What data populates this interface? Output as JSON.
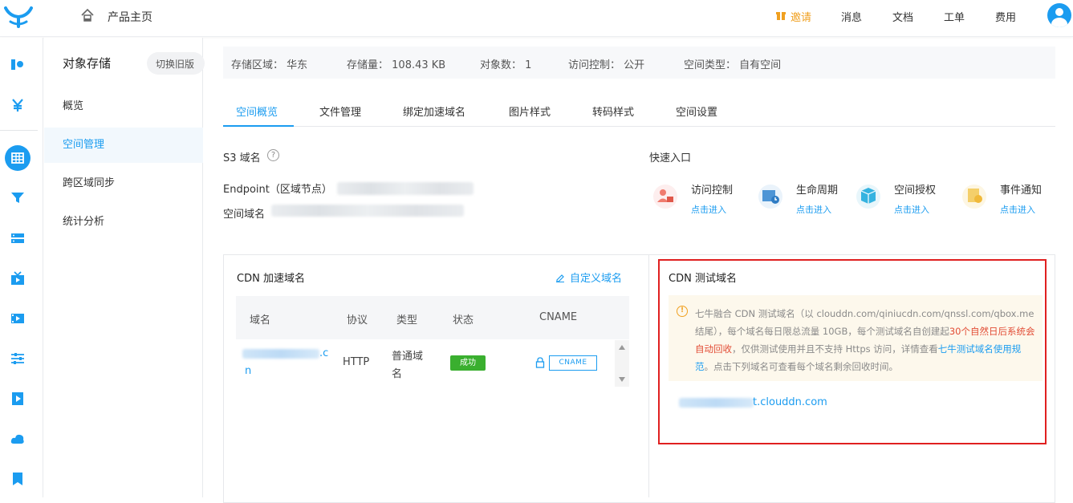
{
  "header": {
    "home_label": "产品主页",
    "nav": [
      "邀请",
      "消息",
      "文档",
      "工单",
      "费用"
    ]
  },
  "colors": {
    "accent": "#1b9cf0",
    "success": "#3aaf2f",
    "highlight_border": "#e02020",
    "warning": "#f0a020"
  },
  "sidebar": {
    "title": "对象存储",
    "switch_label": "切换旧版",
    "items": [
      {
        "label": "概览"
      },
      {
        "label": "空间管理",
        "active": true
      },
      {
        "label": "跨区域同步"
      },
      {
        "label": "统计分析"
      }
    ]
  },
  "info": [
    {
      "label": "存储区域：",
      "value": "华东"
    },
    {
      "label": "存储量：",
      "value": "108.43 KB"
    },
    {
      "label": "对象数：",
      "value": "1"
    },
    {
      "label": "访问控制：",
      "value": "公开"
    },
    {
      "label": "空间类型：",
      "value": "自有空间"
    }
  ],
  "tabs": [
    {
      "label": "空间概览",
      "active": true
    },
    {
      "label": "文件管理"
    },
    {
      "label": "绑定加速域名"
    },
    {
      "label": "图片样式"
    },
    {
      "label": "转码样式"
    },
    {
      "label": "空间设置"
    }
  ],
  "s3": {
    "title": "S3 域名",
    "endpoint_label": "Endpoint（区域节点）",
    "bucket_domain_label": "空间域名"
  },
  "quick": {
    "title": "快速入口",
    "items": [
      {
        "label": "访问控制",
        "link": "点击进入",
        "icon": "access-control-icon"
      },
      {
        "label": "生命周期",
        "link": "点击进入",
        "icon": "lifecycle-icon"
      },
      {
        "label": "空间授权",
        "link": "点击进入",
        "icon": "bucket-authorization-icon"
      },
      {
        "label": "事件通知",
        "link": "点击进入",
        "icon": "event-notification-icon"
      }
    ]
  },
  "cdn": {
    "title": "CDN 加速域名",
    "custom_link": "自定义域名",
    "columns": [
      "域名",
      "协议",
      "类型",
      "状态",
      "CNAME"
    ],
    "rows": [
      {
        "domain_tail_1": ".c",
        "domain_tail_2": "n",
        "protocol": "HTTP",
        "type_1": "普通域",
        "type_2": "名",
        "status": "成功",
        "cname": "CNAME"
      }
    ]
  },
  "test_domain": {
    "title": "CDN 测试域名",
    "notice_1": "七牛融合 CDN 测试域名（以 clouddn.com/qiniucdn.com/qnssl.com/qbox.me 结尾），每个域名每日限总流量 10GB，每个测试域名自创建起",
    "notice_red": "30个自然日后系统会自动回收",
    "notice_2": "，仅供测试使用并且不支持 Https 访问，详情查看",
    "notice_link": "七牛测试域名使用规范",
    "notice_3": "。点击下列域名可查看每个域名剩余回收时间。",
    "domain_tail": "t.clouddn.com"
  }
}
